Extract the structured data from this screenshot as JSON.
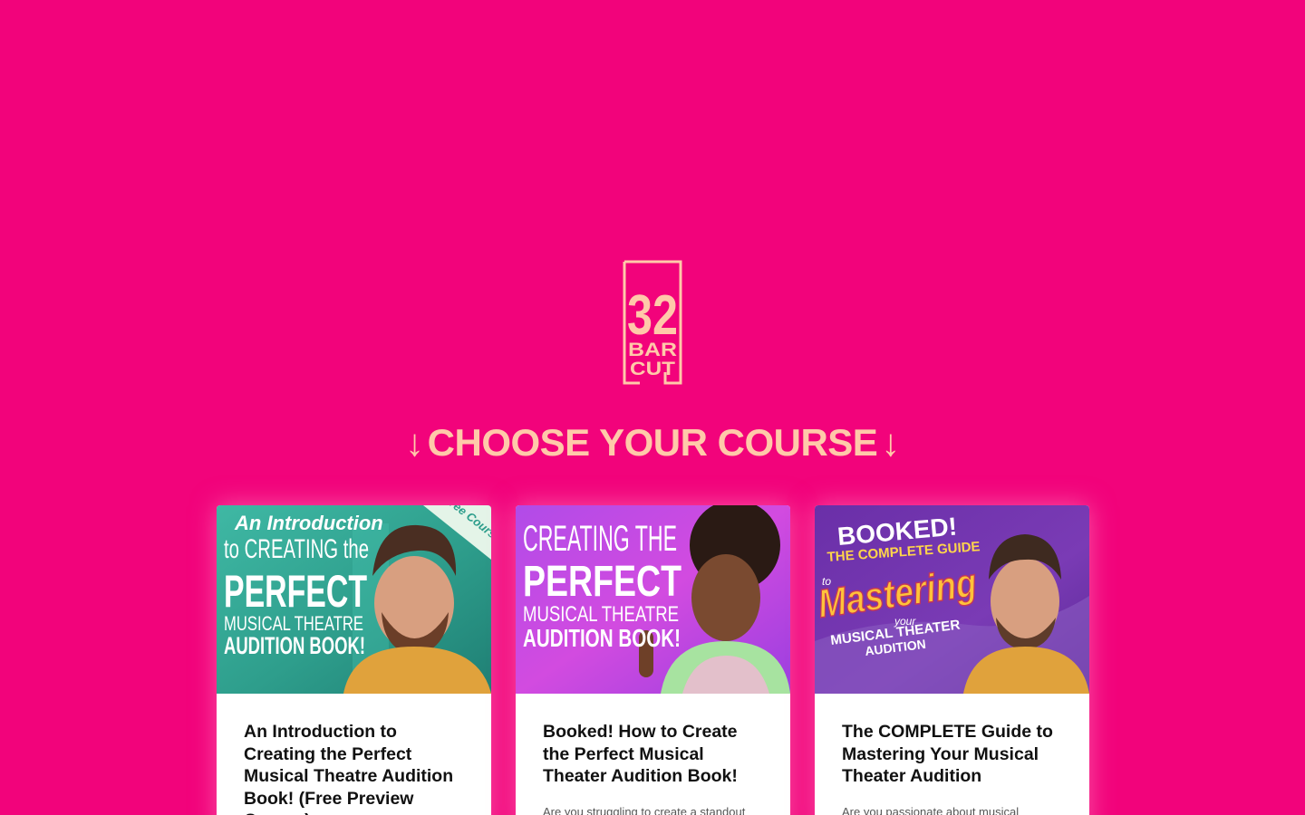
{
  "logo": {
    "icon": "32-bar-cut-logo",
    "number": "32",
    "line1": "BAR",
    "line2": "CUT",
    "color": "#FFC9A9"
  },
  "heading": {
    "arrow_left": "↓",
    "text": "CHOOSE YOUR COURSE",
    "arrow_right": "↓",
    "color": "#FFC9A9"
  },
  "background_color": "#F2037B",
  "courses": [
    {
      "image": {
        "line_a": "An Introduction",
        "line_b": "to CREATING the",
        "line_c": "PERFECT",
        "line_d": "MUSICAL THEATRE",
        "line_e": "AUDITION BOOK!",
        "ribbon": "Free Course"
      },
      "title": "An Introduction to Creating the Perfect Musical Theatre Audition Book! (Free Preview Course)",
      "description": ""
    },
    {
      "image": {
        "line_a": "CREATING THE",
        "line_b": "PERFECT",
        "line_c": "MUSICAL THEATRE",
        "line_d": "AUDITION BOOK!"
      },
      "title": "Booked! How to Create the Perfect Musical Theater Audition Book!",
      "description": "Are you struggling to create a standout"
    },
    {
      "image": {
        "line_a": "BOOKED!",
        "line_b": "THE COMPLETE GUIDE",
        "line_c": "to",
        "line_d": "Mastering",
        "line_e": "your",
        "line_f": "MUSICAL THEATER",
        "line_g": "AUDITION"
      },
      "title": "The COMPLETE Guide to Mastering Your Musical Theater Audition",
      "description": "Are you passionate about musical"
    }
  ]
}
